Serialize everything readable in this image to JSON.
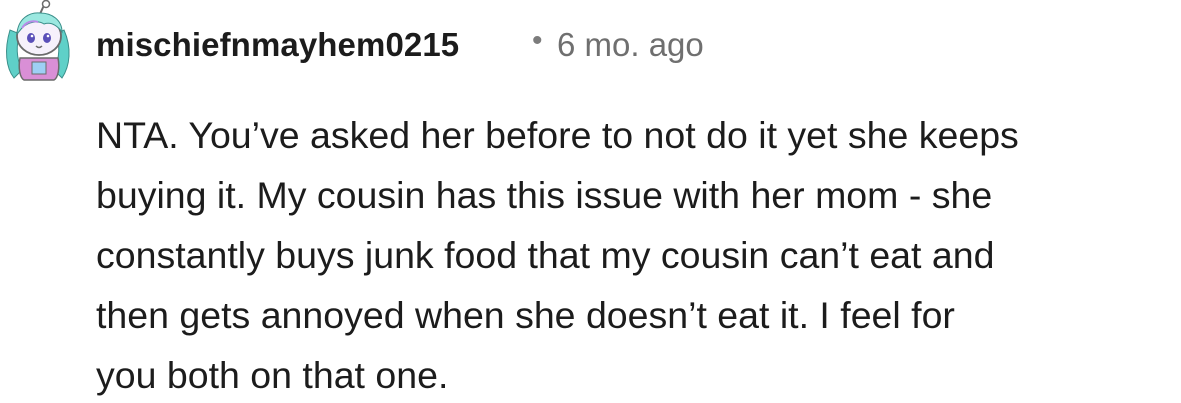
{
  "comment": {
    "username": "mischiefnmayhem0215",
    "separator": "•",
    "timestamp": "6 mo. ago",
    "body_lines": [
      "NTA. You’ve asked her before to not do it yet she keeps",
      "buying it. My cousin has this issue with her mom - she",
      "constantly buys junk food that my cousin can’t eat and",
      "then gets annoyed when she doesn’t eat it. I feel for",
      "you both on that one."
    ],
    "avatar_icon": "snoo-avatar-icon"
  }
}
